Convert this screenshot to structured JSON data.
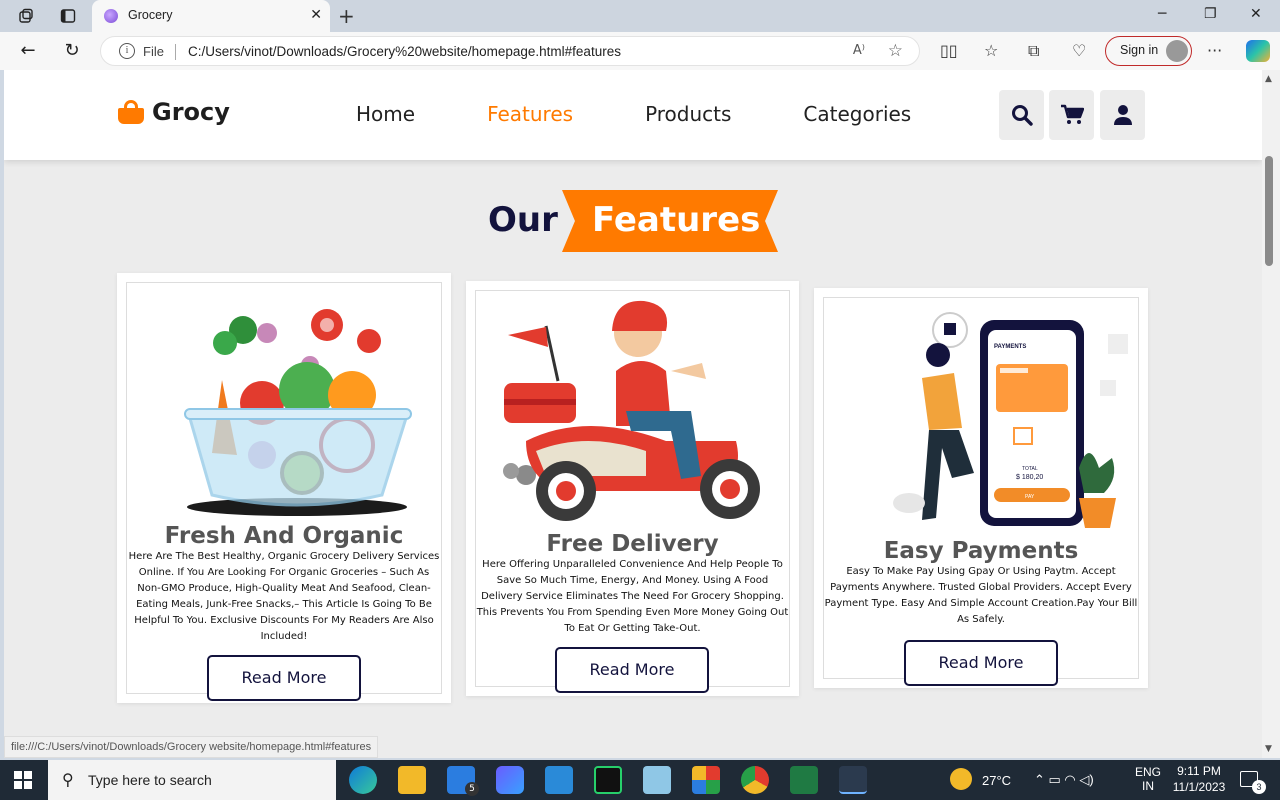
{
  "browser": {
    "tab_title": "Grocery",
    "tab_close": "✕",
    "new_tab": "+",
    "address_scheme": "File",
    "address_url": "C:/Users/vinot/Downloads/Grocery%20website/homepage.html#features",
    "sign_in": "Sign in",
    "status_url": "file:///C:/Users/vinot/Downloads/Grocery website/homepage.html#features"
  },
  "site": {
    "logo_text": "Grocy",
    "nav": [
      {
        "label": "Home",
        "active": false
      },
      {
        "label": "Features",
        "active": true
      },
      {
        "label": "Products",
        "active": false
      },
      {
        "label": "Categories",
        "active": false
      }
    ],
    "header_icons": [
      "search-icon",
      "cart-icon",
      "user-icon"
    ],
    "accent_color": "#ff7a00",
    "dark_color": "#13133d"
  },
  "features": {
    "heading_part1": "Our",
    "heading_part2": "Features",
    "cards": [
      {
        "title": "Fresh And Organic",
        "text": "Here Are The Best Healthy, Organic Grocery Delivery Services Online. If You Are Looking For Organic Groceries – Such As Non-GMO Produce, High-Quality Meat And Seafood, Clean-Eating Meals, Junk-Free Snacks,– This Article Is Going To Be Helpful To You. Exclusive Discounts For My Readers Are Also Included!",
        "button": "Read More",
        "image": "vegetable-bowl-illustration"
      },
      {
        "title": "Free Delivery",
        "text": "Here Offering Unparalleled Convenience And Help People To Save So Much Time, Energy, And Money. Using A Food Delivery Service Eliminates The Need For Grocery Shopping. This Prevents You From Spending Even More Money Going Out To Eat Or Getting Take-Out.",
        "button": "Read More",
        "image": "scooter-delivery-illustration"
      },
      {
        "title": "Easy Payments",
        "text": "Easy To Make Pay Using Gpay Or Using Paytm. Accept Payments Anywhere. Trusted Global Providers. Accept Every Payment Type. Easy And Simple Account Creation.Pay Your Bill As Safely.",
        "button": "Read More",
        "image": "mobile-payment-illustration",
        "phone": {
          "header": "PAYMENTS",
          "total_label": "TOTAL",
          "total_value": "$ 180,20",
          "pay_button": "PAY"
        }
      }
    ]
  },
  "taskbar": {
    "search_placeholder": "Type here to search",
    "weather": "27°C",
    "language_line1": "ENG",
    "language_line2": "IN",
    "time": "9:11 PM",
    "date": "11/1/2023",
    "mail_badge": "5",
    "notification_count": "3"
  }
}
